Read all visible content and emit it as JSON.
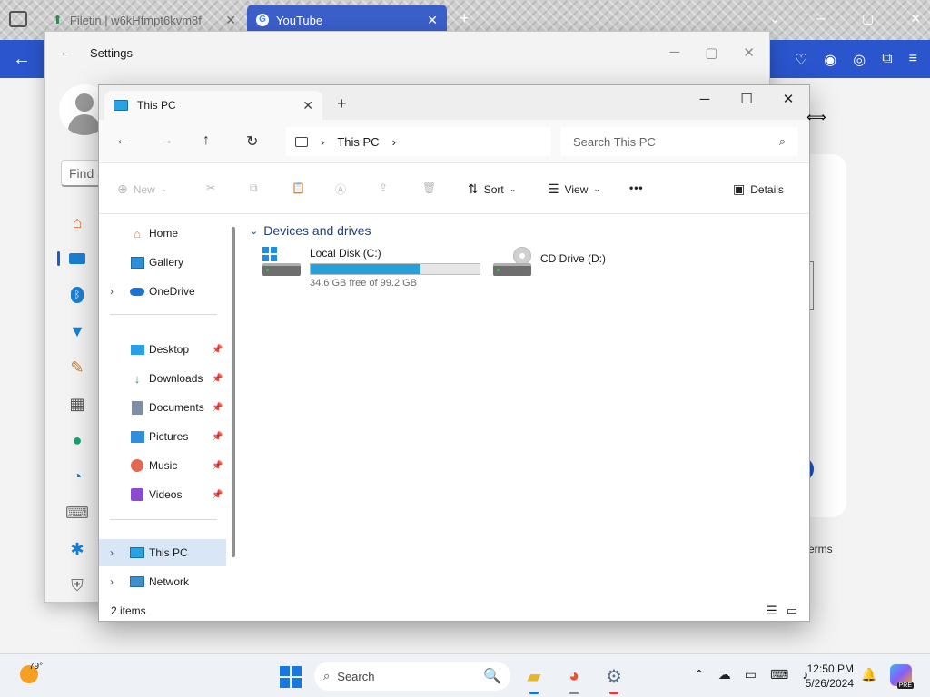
{
  "browser": {
    "tabs": [
      {
        "label": "Filetin | w6kHfmpt6kvm8f",
        "active": false
      },
      {
        "label": "YouTube",
        "active": true
      }
    ],
    "accent": "#2a55cc"
  },
  "background": {
    "terms_text": "erms"
  },
  "settings": {
    "title": "Settings",
    "search_placeholder": "Find a",
    "nav_icons": [
      "home-icon",
      "system-icon",
      "bluetooth-icon",
      "wifi-icon",
      "personalization-icon",
      "apps-icon",
      "accounts-icon",
      "time-icon",
      "gaming-icon",
      "accessibility-icon",
      "privacy-icon"
    ]
  },
  "explorer": {
    "tab_title": "This PC",
    "address": {
      "location": "This PC"
    },
    "search_placeholder": "Search This PC",
    "commands": {
      "new": "New",
      "sort": "Sort",
      "view": "View",
      "more": "•••",
      "details": "Details"
    },
    "sidebar": {
      "quick": [
        {
          "label": "Home",
          "icon": "home-icon"
        },
        {
          "label": "Gallery",
          "icon": "gallery-icon"
        },
        {
          "label": "OneDrive",
          "icon": "onedrive-icon",
          "expandable": true
        }
      ],
      "pinned": [
        {
          "label": "Desktop",
          "icon": "desktop-icon"
        },
        {
          "label": "Downloads",
          "icon": "downloads-icon"
        },
        {
          "label": "Documents",
          "icon": "documents-icon"
        },
        {
          "label": "Pictures",
          "icon": "pictures-icon"
        },
        {
          "label": "Music",
          "icon": "music-icon"
        },
        {
          "label": "Videos",
          "icon": "videos-icon"
        }
      ],
      "locations": [
        {
          "label": "This PC",
          "icon": "this-pc-icon",
          "selected": true
        },
        {
          "label": "Network",
          "icon": "network-icon"
        }
      ]
    },
    "section_title": "Devices and drives",
    "drives": [
      {
        "name": "Local Disk (C:)",
        "free_text": "34.6 GB free of 99.2 GB",
        "used_fraction": 0.65
      },
      {
        "name": "CD Drive (D:)"
      }
    ],
    "status": "2 items"
  },
  "taskbar": {
    "weather_temp": "79°",
    "search_label": "Search",
    "time": "12:50 PM",
    "date": "5/26/2024",
    "copilot_badge": "PRE"
  }
}
